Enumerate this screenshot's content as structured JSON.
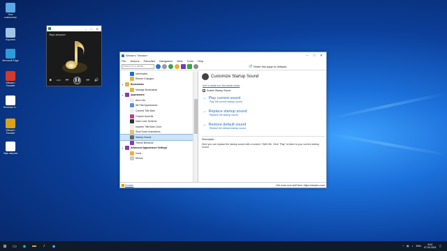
{
  "desktop": {
    "icons": [
      {
        "label": "Этот компьютер",
        "color": "#5aa9e6"
      },
      {
        "label": "Корзина",
        "color": "#9fc4e6"
      },
      {
        "label": "Microsoft Edge",
        "color": "#2e9bd6"
      },
      {
        "label": "Winaero Tweaker",
        "color": "#d33a2c"
      },
      {
        "label": "Windows S...",
        "color": "#ffffff"
      },
      {
        "label": "Winaero Tweaker",
        "color": "#d8a21a"
      },
      {
        "label": "Звук запуска",
        "color": "#ffffff"
      }
    ]
  },
  "player": {
    "title": "Звук запуска",
    "time": "0:00"
  },
  "window": {
    "title": "Winaero Tweaker",
    "menu": [
      "File",
      "Actions",
      "Favorites",
      "Navigation",
      "View",
      "Tools",
      "Help"
    ],
    "search_placeholder": "Search for a tweak...",
    "reset_label": "Reset this page to defaults",
    "tree": [
      {
        "label": "Information",
        "type": "item",
        "color": "#1e6fd0"
      },
      {
        "label": "Recent Changes",
        "type": "item",
        "color": "#e0b542"
      },
      {
        "label": "Bookmarks",
        "type": "cat",
        "color": "#e0b542"
      },
      {
        "label": "Manage Bookmarks",
        "type": "item",
        "color": "#e0b542"
      },
      {
        "label": "Appearance",
        "type": "cat",
        "color": "#8a3ab9"
      },
      {
        "label": "Aero Lite",
        "type": "item",
        "color": "#eeeeee"
      },
      {
        "label": "Alt+Tab Appearance",
        "type": "item",
        "color": "#5b8fd6"
      },
      {
        "label": "Colored Title Bars",
        "type": "item",
        "color": "#eeeeee"
      },
      {
        "label": "Custom Accents",
        "type": "item",
        "color": "#c23b8a"
      },
      {
        "label": "Dark Color Scheme",
        "type": "item",
        "color": "#333333"
      },
      {
        "label": "Inactive Title Bars Color",
        "type": "item",
        "color": "#eeeeee"
      },
      {
        "label": "Slow Down Animations",
        "type": "item",
        "color": "#e8c066"
      },
      {
        "label": "Startup Sound",
        "type": "item",
        "color": "#666666",
        "selected": true
      },
      {
        "label": "Theme Behavior",
        "type": "item",
        "color": "#8a3ab9"
      },
      {
        "label": "Advanced Appearance Settings",
        "type": "cat",
        "color": "#8a3ab9"
      },
      {
        "label": "Icons",
        "type": "item",
        "color": "#e0b542"
      },
      {
        "label": "Menus",
        "type": "item",
        "color": "#cccccc"
      }
    ],
    "pane": {
      "heading": "Customize Startup Sound",
      "link": "See in detail how this tweak works",
      "checkbox_label": "Enable Startup Sound",
      "checked": "✓",
      "actions": [
        {
          "title": "Play current sound",
          "subtitle": "Play the current startup sound"
        },
        {
          "title": "Replace startup sound",
          "subtitle": "Replace the startup sound"
        },
        {
          "title": "Restore default sound",
          "subtitle": "Restore the default startup sound"
        }
      ],
      "desc_heading": "Description",
      "desc_text": "Here you can replace the startup sound with a custom *.WAV file. Click \"Play\" to listen to your current startup sound."
    },
    "status": {
      "donate": "Donate!",
      "right": "Get more cool stuff here: https://winaero.com"
    }
  },
  "taskbar": {
    "lang": "ENG",
    "time": "8:02",
    "date": "07.04.2021"
  }
}
